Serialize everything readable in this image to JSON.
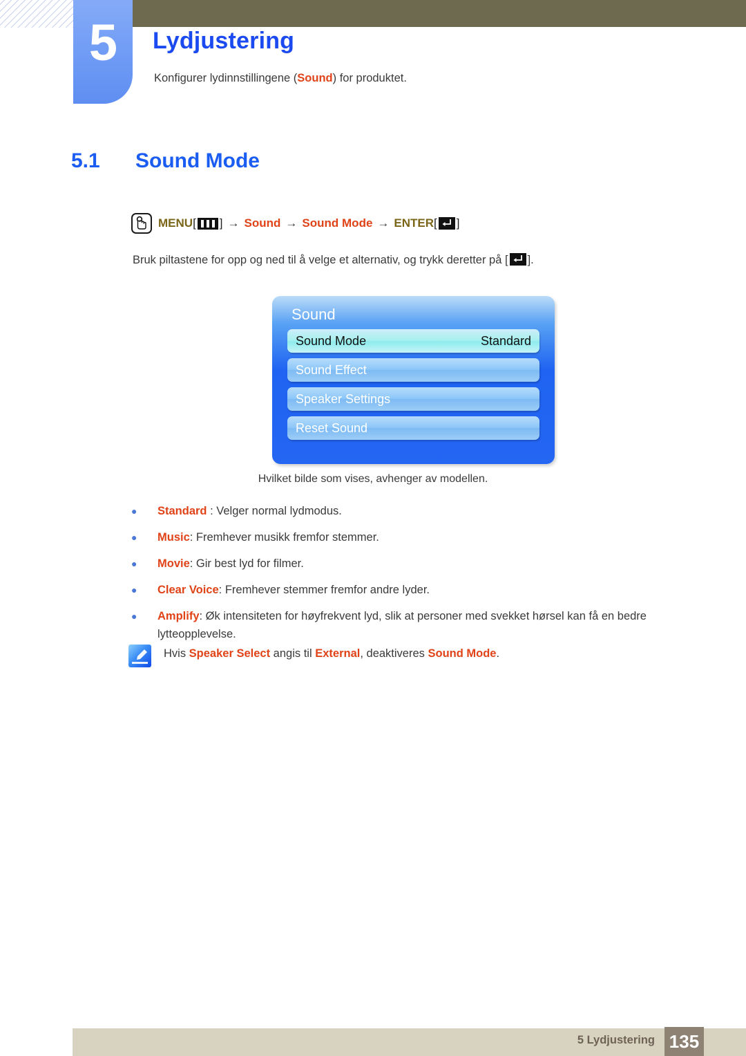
{
  "chapter": {
    "number": "5",
    "title": "Lydjustering",
    "subtitle_pre": "Konfigurer lydinnstillingene (",
    "subtitle_highlight": "Sound",
    "subtitle_post": ") for produktet."
  },
  "section": {
    "number": "5.1",
    "title": "Sound Mode"
  },
  "menu_path": {
    "hand_icon": "hand-press-icon",
    "menu_label": "MENU",
    "menu_key_icon": "menu-bars-icon",
    "bracket_open": "[",
    "bracket_close": "]",
    "arrow": "→",
    "item1": "Sound",
    "item2": "Sound Mode",
    "enter_label": "ENTER",
    "enter_key_icon": "enter-key-icon"
  },
  "instruction": {
    "pre": "Bruk piltastene for opp og ned til å velge et alternativ, og trykk deretter på [",
    "post": "]."
  },
  "osd": {
    "title": "Sound",
    "rows": [
      {
        "label": "Sound Mode",
        "value": "Standard",
        "selected": true
      },
      {
        "label": "Sound Effect",
        "value": "",
        "selected": false
      },
      {
        "label": "Speaker Settings",
        "value": "",
        "selected": false
      },
      {
        "label": "Reset Sound",
        "value": "",
        "selected": false
      }
    ]
  },
  "osd_caption": "Hvilket bilde som vises, avhenger av modellen.",
  "bullets": [
    {
      "dot": "●",
      "term": "Standard",
      "rest": " : Velger normal lydmodus."
    },
    {
      "dot": "●",
      "term": "Music",
      "rest": ": Fremhever musikk fremfor stemmer."
    },
    {
      "dot": "●",
      "term": "Movie",
      "rest": ": Gir best lyd for filmer."
    },
    {
      "dot": "●",
      "term": "Clear Voice",
      "rest": ": Fremhever stemmer fremfor andre lyder."
    },
    {
      "dot": "●",
      "term": "Amplify",
      "rest": ": Øk intensiteten for høyfrekvent lyd, slik at personer med svekket hørsel kan få en bedre lytteopplevelse."
    }
  ],
  "note": {
    "icon": "note-pen-icon",
    "p1": "Hvis ",
    "b1": "Speaker Select",
    "p2": " angis til ",
    "b2": "External",
    "p3": ", deaktiveres ",
    "b3": "Sound Mode",
    "p4": "."
  },
  "footer": {
    "label": "5 Lydjustering",
    "page": "135"
  },
  "colors": {
    "accent_blue": "#1b4af0",
    "heading_blue": "#1b5cf2",
    "olive_bar": "#6e6a50",
    "menu_olive": "#7a6518",
    "highlight_red": "#e04318",
    "tab_blue": "#6f9bf5",
    "footer_beige": "#d8d2c0",
    "footer_page_box": "#8e8275"
  }
}
